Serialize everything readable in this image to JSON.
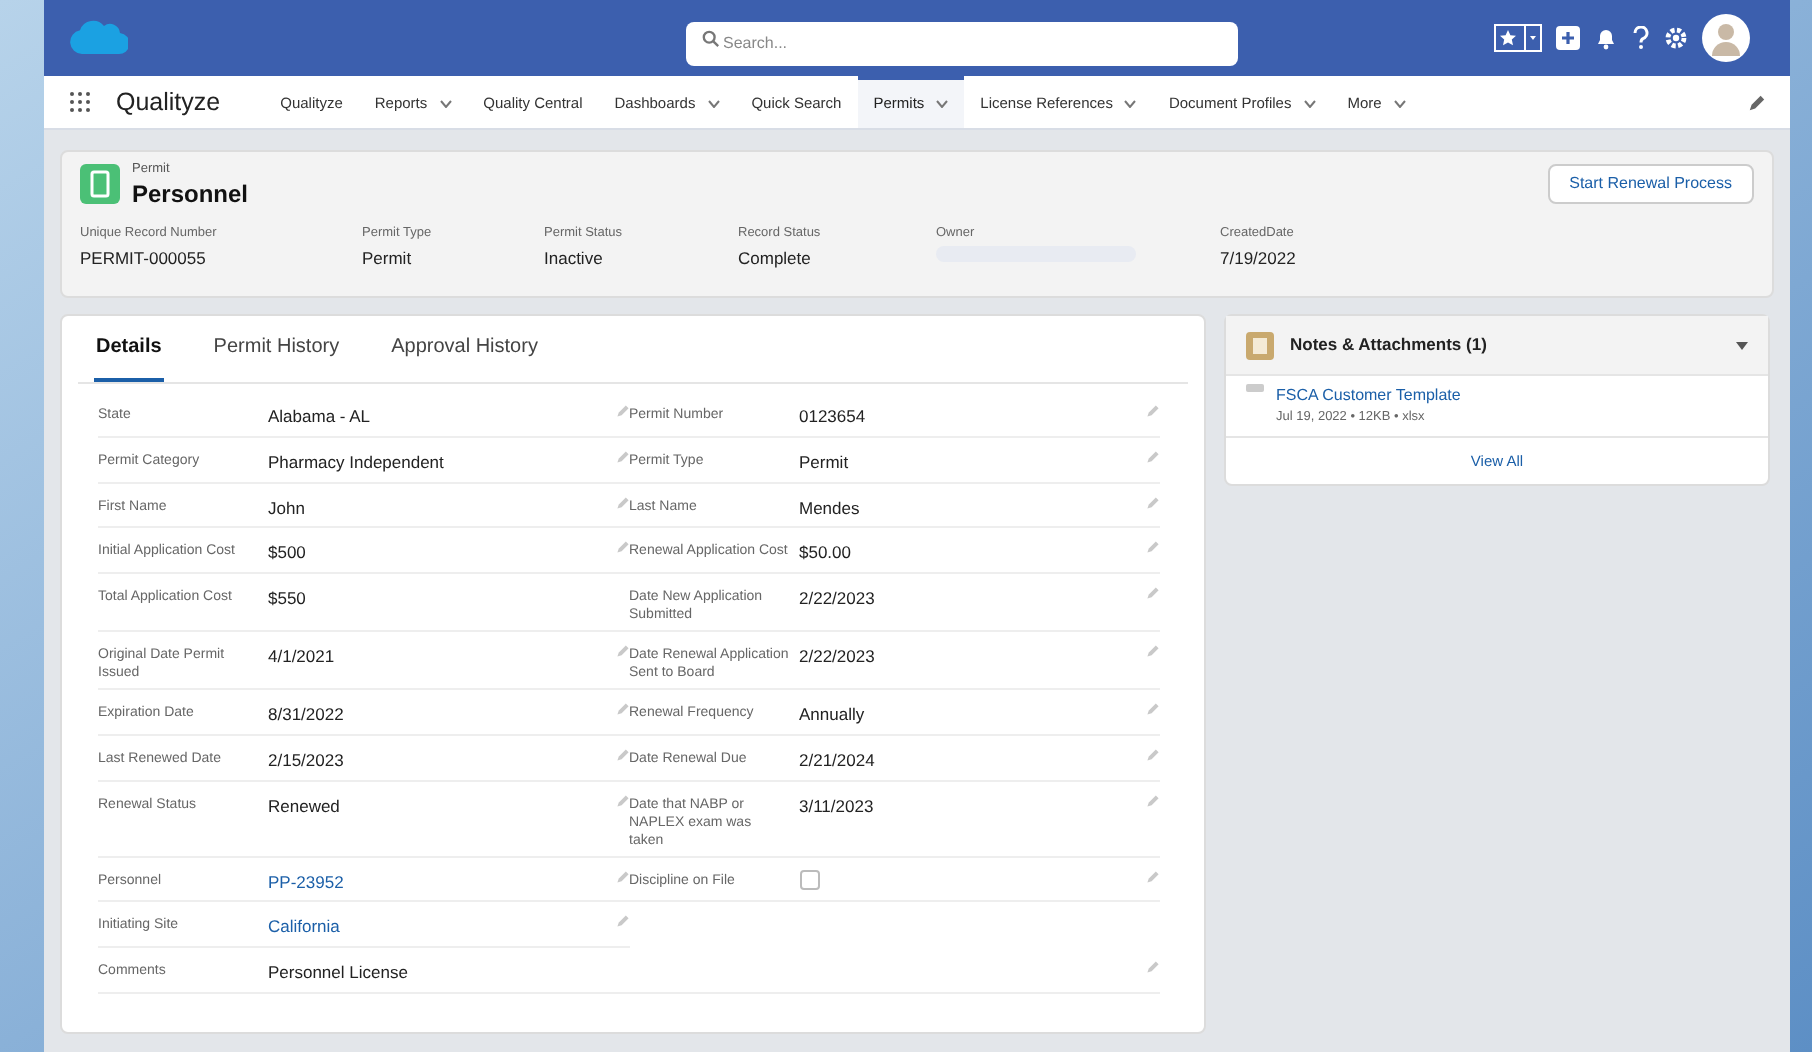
{
  "header": {
    "search": {
      "placeholder": "Search..."
    }
  },
  "nav": {
    "app_name": "Qualityze",
    "items": [
      {
        "label": "Qualityze",
        "dropdown": false,
        "selected": false
      },
      {
        "label": "Reports",
        "dropdown": true,
        "selected": false
      },
      {
        "label": "Quality Central",
        "dropdown": false,
        "selected": false
      },
      {
        "label": "Dashboards",
        "dropdown": true,
        "selected": false
      },
      {
        "label": "Quick Search",
        "dropdown": false,
        "selected": false
      },
      {
        "label": "Permits",
        "dropdown": true,
        "selected": true
      },
      {
        "label": "License References",
        "dropdown": true,
        "selected": false
      },
      {
        "label": "Document Profiles",
        "dropdown": true,
        "selected": false
      },
      {
        "label": "More",
        "dropdown": true,
        "selected": false
      }
    ]
  },
  "record": {
    "object": "Permit",
    "name": "Personnel",
    "action": "Start Renewal Process",
    "fields": [
      {
        "label": "Unique Record Number",
        "value": "PERMIT-000055"
      },
      {
        "label": "Permit Type",
        "value": "Permit"
      },
      {
        "label": "Permit Status",
        "value": "Inactive"
      },
      {
        "label": "Record Status",
        "value": "Complete"
      },
      {
        "label": "Owner",
        "redacted": true
      },
      {
        "label": "CreatedDate",
        "value": "7/19/2022"
      }
    ]
  },
  "tabs": [
    {
      "label": "Details",
      "selected": true
    },
    {
      "label": "Permit History",
      "selected": false
    },
    {
      "label": "Approval History",
      "selected": false
    }
  ],
  "details": [
    {
      "left": {
        "label": "State",
        "value": "Alabama - AL",
        "kind": "text",
        "editable": true
      },
      "right": {
        "label": "Permit Number",
        "value": "0123654",
        "kind": "text",
        "editable": true
      }
    },
    {
      "left": {
        "label": "Permit Category",
        "value": "Pharmacy Independent",
        "kind": "text",
        "editable": true
      },
      "right": {
        "label": "Permit Type",
        "value": "Permit",
        "kind": "text",
        "editable": true
      }
    },
    {
      "left": {
        "label": "First Name",
        "value": "John",
        "kind": "text",
        "editable": true
      },
      "right": {
        "label": "Last Name",
        "value": "Mendes",
        "kind": "text",
        "editable": true
      }
    },
    {
      "left": {
        "label": "Initial Application Cost",
        "value": "$500",
        "kind": "text",
        "editable": true
      },
      "right": {
        "label": "Renewal Application Cost",
        "value": "$50.00",
        "kind": "text",
        "editable": true
      }
    },
    {
      "left": {
        "label": "Total Application Cost",
        "value": "$550",
        "kind": "text",
        "editable": false
      },
      "right": {
        "label": "Date New Application Submitted",
        "value": "2/22/2023",
        "kind": "text",
        "editable": true
      }
    },
    {
      "left": {
        "label": "Original Date Permit Issued",
        "value": "4/1/2021",
        "kind": "text",
        "editable": true
      },
      "right": {
        "label": "Date Renewal Application Sent to Board",
        "value": "2/22/2023",
        "kind": "text",
        "editable": true
      }
    },
    {
      "left": {
        "label": "Expiration Date",
        "value": "8/31/2022",
        "kind": "text",
        "editable": true
      },
      "right": {
        "label": "Renewal Frequency",
        "value": "Annually",
        "kind": "text",
        "editable": true
      }
    },
    {
      "left": {
        "label": "Last Renewed Date",
        "value": "2/15/2023",
        "kind": "text",
        "editable": true
      },
      "right": {
        "label": "Date Renewal Due",
        "value": "2/21/2024",
        "kind": "text",
        "editable": true
      }
    },
    {
      "left": {
        "label": "Renewal Status",
        "value": "Renewed",
        "kind": "text",
        "editable": true
      },
      "right": {
        "label": "Date that NABP or NAPLEX exam was taken",
        "value": "3/11/2023",
        "kind": "text",
        "editable": true
      }
    },
    {
      "left": {
        "label": "Personnel",
        "value": "PP-23952",
        "kind": "link",
        "editable": true
      },
      "right": {
        "label": "Discipline on File",
        "kind": "checkbox",
        "checked": false,
        "editable": true
      }
    },
    {
      "left": {
        "label": "Initiating Site",
        "value": "California",
        "kind": "link",
        "editable": true
      }
    },
    {
      "left": {
        "label": "Comments",
        "value": "Personnel License",
        "kind": "text",
        "editable": true
      },
      "wide": true
    }
  ],
  "notes": {
    "title": "Notes & Attachments (1)",
    "files": [
      {
        "name": "FSCA Customer Template",
        "meta": "Jul 19, 2022 • 12KB • xlsx"
      }
    ],
    "footer": "View All"
  }
}
